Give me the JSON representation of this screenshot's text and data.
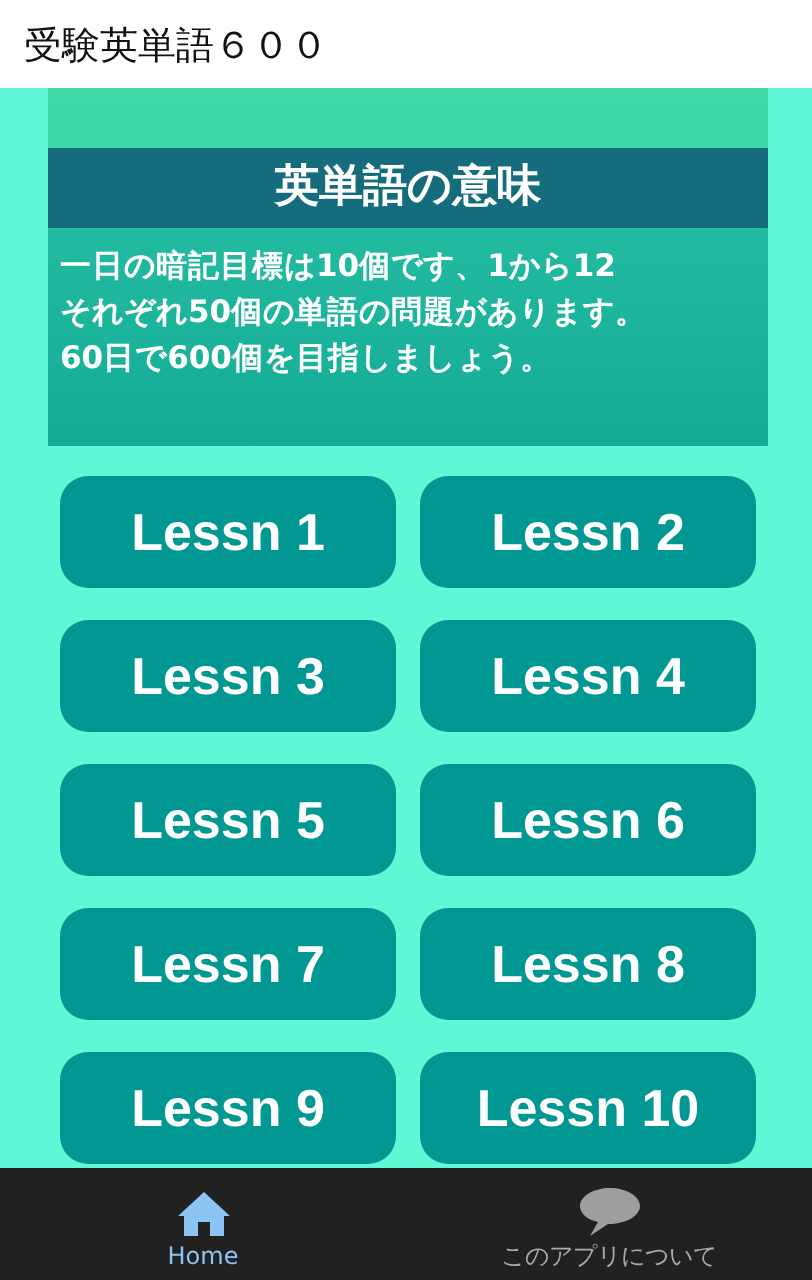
{
  "app_bar": {
    "title": "受験英単語６００"
  },
  "banner": {
    "heading": "英単語の意味",
    "lines": [
      "一日の暗記目標は10個です、1から12",
      "それぞれ50個の単語の問題があります。",
      "60日で600個を目指しましょう。"
    ]
  },
  "lessons": [
    {
      "label": "Lessn 1"
    },
    {
      "label": "Lessn 2"
    },
    {
      "label": "Lessn 3"
    },
    {
      "label": "Lessn 4"
    },
    {
      "label": "Lessn 5"
    },
    {
      "label": "Lessn 6"
    },
    {
      "label": "Lessn 7"
    },
    {
      "label": "Lessn 8"
    },
    {
      "label": "Lessn 9"
    },
    {
      "label": "Lessn 10"
    }
  ],
  "bottom_nav": [
    {
      "label": "Home",
      "kind": "home",
      "selected": true
    },
    {
      "label": "このアプリについて",
      "kind": "chat",
      "selected": false
    }
  ]
}
